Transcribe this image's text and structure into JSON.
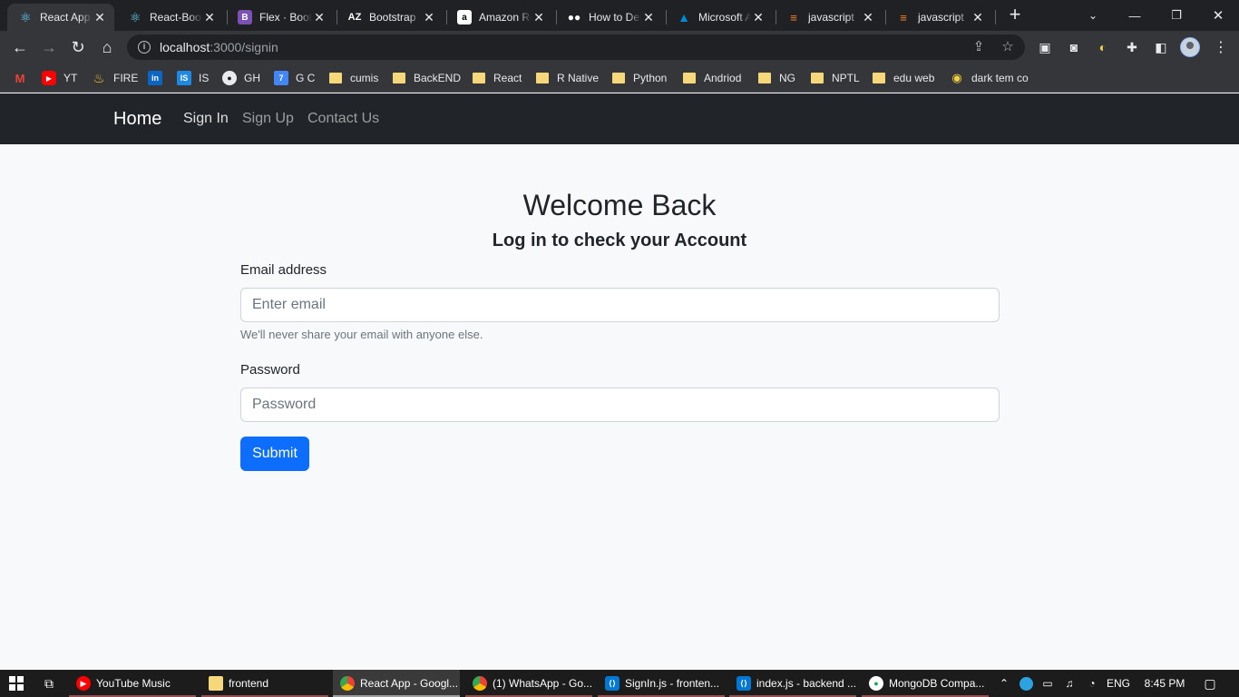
{
  "browser": {
    "tabs": [
      {
        "title": "React App",
        "icon": "react-icon",
        "active": true
      },
      {
        "title": "React-Bootstrap",
        "icon": "react-bootstrap-icon",
        "active": false
      },
      {
        "title": "Flex · Bootstrap",
        "icon": "bootstrap-icon",
        "active": false
      },
      {
        "title": "Bootstrap",
        "icon": "az-icon",
        "active": false
      },
      {
        "title": "Amazon Rekognition",
        "icon": "amazon-icon",
        "active": false
      },
      {
        "title": "How to Deploy",
        "icon": "medium-icon",
        "active": false
      },
      {
        "title": "Microsoft Azure",
        "icon": "azure-icon",
        "active": false
      },
      {
        "title": "javascript",
        "icon": "stackoverflow-icon",
        "active": false
      },
      {
        "title": "javascript",
        "icon": "stackoverflow-icon",
        "active": false
      }
    ],
    "url_host": "localhost",
    "url_path": ":3000/signin",
    "bookmarks": [
      {
        "label": "",
        "icon": "gmail-icon"
      },
      {
        "label": "YT",
        "icon": "youtube-icon"
      },
      {
        "label": "FIRE",
        "icon": "firebase-icon"
      },
      {
        "label": "",
        "icon": "linkedin-icon"
      },
      {
        "label": "IS",
        "icon": "is-icon"
      },
      {
        "label": "GH",
        "icon": "github-icon"
      },
      {
        "label": "G C",
        "icon": "calendar-icon"
      },
      {
        "label": "cumis",
        "icon": "folder-icon"
      },
      {
        "label": "BackEND",
        "icon": "folder-icon"
      },
      {
        "label": "React",
        "icon": "folder-icon"
      },
      {
        "label": "R Native",
        "icon": "folder-icon"
      },
      {
        "label": "Python",
        "icon": "folder-icon"
      },
      {
        "label": "Andriod",
        "icon": "folder-icon"
      },
      {
        "label": "NG",
        "icon": "folder-icon"
      },
      {
        "label": "NPTL",
        "icon": "folder-icon"
      },
      {
        "label": "edu web",
        "icon": "folder-icon"
      },
      {
        "label": "dark tem co",
        "icon": "extension-icon"
      }
    ]
  },
  "navbar": {
    "brand": "Home",
    "links": [
      "Sign In",
      "Sign Up",
      "Contact Us"
    ]
  },
  "form": {
    "heading": "Welcome Back",
    "subheading": "Log in to check your Account",
    "email_label": "Email address",
    "email_placeholder": "Enter email",
    "email_value": "",
    "email_help": "We'll never share your email with anyone else.",
    "password_label": "Password",
    "password_placeholder": "Password",
    "password_value": "",
    "submit_label": "Submit"
  },
  "taskbar": {
    "apps": [
      {
        "label": "YouTube Music",
        "icon": "youtube-music-icon",
        "active": false
      },
      {
        "label": "frontend",
        "icon": "folder-icon",
        "active": false
      },
      {
        "label": "React App - Googl...",
        "icon": "chrome-icon",
        "active": true
      },
      {
        "label": "(1) WhatsApp - Go...",
        "icon": "chrome-icon",
        "active": false
      },
      {
        "label": "SignIn.js - fronten...",
        "icon": "vscode-icon",
        "active": false
      },
      {
        "label": "index.js - backend ...",
        "icon": "vscode-icon",
        "active": false
      },
      {
        "label": "MongoDB Compa...",
        "icon": "mongodb-icon",
        "active": false
      }
    ],
    "language": "ENG",
    "time": "8:45 PM"
  },
  "colors": {
    "navbar_bg": "#212529",
    "page_bg": "#f8f9fa",
    "primary": "#0d6efd",
    "chrome_dark": "#202124",
    "chrome_toolbar": "#35363a"
  }
}
